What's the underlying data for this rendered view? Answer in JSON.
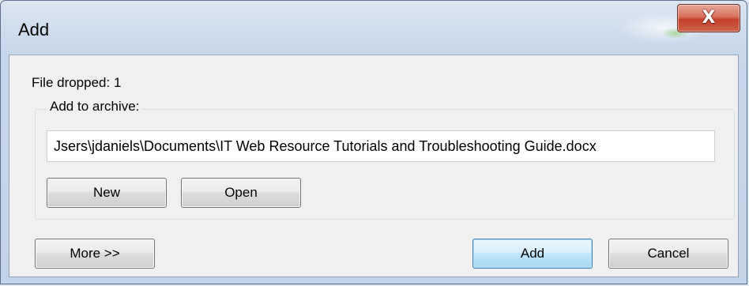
{
  "window": {
    "title": "Add",
    "close_glyph": "X"
  },
  "dialog": {
    "file_dropped": "File dropped: 1",
    "group_label": "Add to archive:",
    "archive_path": "Jsers\\jdaniels\\Documents\\IT Web Resource Tutorials and Troubleshooting Guide.docx",
    "new_label": "New",
    "open_label": "Open",
    "more_label": "More >>",
    "add_label": "Add",
    "cancel_label": "Cancel"
  },
  "colors": {
    "title_bar": "#c7d7ea",
    "client_bg": "#f0f0f0",
    "close_button": "#c23f2a",
    "default_button": "#3c7fb1"
  },
  "icons": [
    "close-icon"
  ]
}
